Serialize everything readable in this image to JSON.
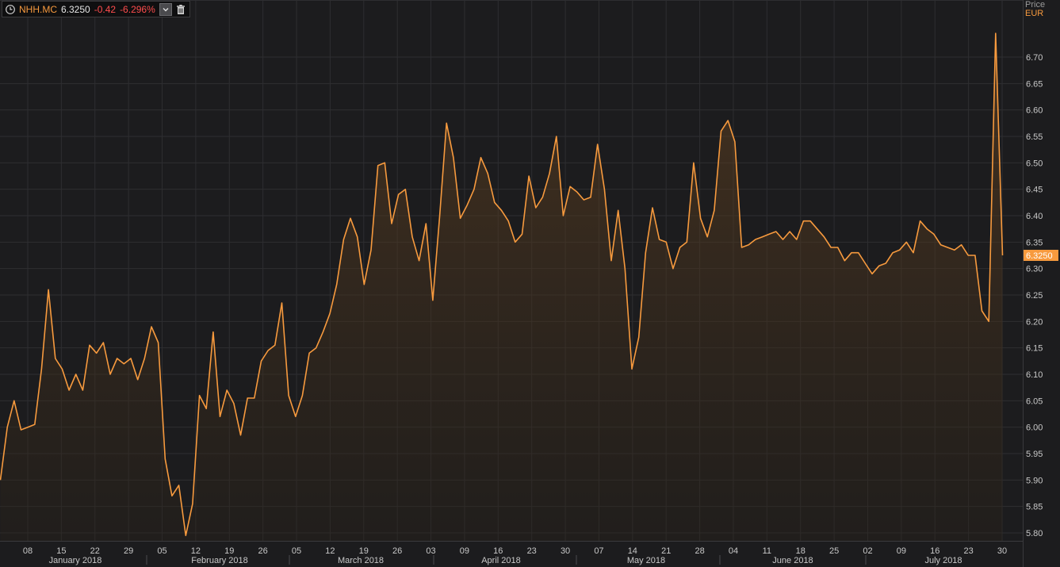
{
  "header": {
    "ticker": "NHH.MC",
    "price": "6.3250",
    "change": "-0.42",
    "change_pct": "-6.296%",
    "clock_icon": "clock-icon",
    "dropdown_icon": "chevron-down-icon",
    "trash_icon": "trash-icon"
  },
  "axis": {
    "price_label": "Price",
    "currency_label": "EUR"
  },
  "colors": {
    "background": "#1c1c1e",
    "line": "#f79a3e",
    "grid": "#2e2e31",
    "axis_text": "#c8c8c8",
    "negative": "#ff4d4d"
  },
  "chart_data": {
    "type": "area",
    "series": [
      {
        "values": [
          5.9,
          6.0,
          6.05,
          5.995,
          6.0,
          6.005,
          6.11,
          6.26,
          6.13,
          6.11,
          6.07,
          6.1,
          6.07,
          6.155,
          6.14,
          6.16,
          6.1,
          6.13,
          6.12,
          6.13,
          6.09,
          6.13,
          6.19,
          6.16,
          5.94,
          5.87,
          5.89,
          5.795,
          5.855,
          6.06,
          6.035,
          6.18,
          6.02,
          6.07,
          6.045,
          5.985,
          6.055,
          6.055,
          6.125,
          6.145,
          6.155,
          6.235,
          6.06,
          6.02,
          6.06,
          6.14,
          6.15,
          6.18,
          6.215,
          6.27,
          6.355,
          6.395,
          6.36,
          6.27,
          6.335,
          6.495,
          6.5,
          6.385,
          6.44,
          6.45,
          6.36,
          6.315,
          6.385,
          6.24,
          6.4,
          6.575,
          6.51,
          6.395,
          6.42,
          6.45,
          6.51,
          6.48,
          6.425,
          6.41,
          6.39,
          6.35,
          6.365,
          6.475,
          6.415,
          6.435,
          6.48,
          6.55,
          6.4,
          6.455,
          6.445,
          6.43,
          6.435,
          6.535,
          6.45,
          6.315,
          6.41,
          6.3,
          6.11,
          6.17,
          6.33,
          6.415,
          6.355,
          6.35,
          6.3,
          6.34,
          6.35,
          6.5,
          6.395,
          6.36,
          6.41,
          6.56,
          6.58,
          6.54,
          6.34,
          6.345,
          6.355,
          6.36,
          6.365,
          6.37,
          6.355,
          6.37,
          6.355,
          6.39,
          6.39,
          6.375,
          6.36,
          6.34,
          6.34,
          6.315,
          6.33,
          6.33,
          6.31,
          6.29,
          6.305,
          6.31,
          6.33,
          6.335,
          6.35,
          6.33,
          6.39,
          6.375,
          6.365,
          6.345,
          6.34,
          6.335,
          6.345,
          6.325,
          6.325,
          6.22,
          6.2,
          6.745,
          6.325
        ]
      }
    ],
    "last_value": "6.3250",
    "ylim": [
      5.785,
      6.775
    ],
    "y_ticks": [
      "5.80",
      "5.85",
      "5.90",
      "5.95",
      "6.00",
      "6.05",
      "6.10",
      "6.15",
      "6.20",
      "6.25",
      "6.30",
      "6.35",
      "6.40",
      "6.45",
      "6.50",
      "6.55",
      "6.60",
      "6.65",
      "6.70"
    ],
    "x_day_ticks": [
      "08",
      "15",
      "22",
      "29",
      "05",
      "12",
      "19",
      "26",
      "05",
      "12",
      "19",
      "26",
      "03",
      "09",
      "16",
      "23",
      "30",
      "07",
      "14",
      "21",
      "28",
      "04",
      "11",
      "18",
      "25",
      "02",
      "09",
      "16",
      "23",
      "30"
    ],
    "x_month_labels": [
      "January 2018",
      "February 2018",
      "March 2018",
      "April 2018",
      "May 2018",
      "June 2018",
      "July 2018"
    ],
    "grid": true,
    "ylabel": "Price",
    "yunit": "EUR"
  }
}
